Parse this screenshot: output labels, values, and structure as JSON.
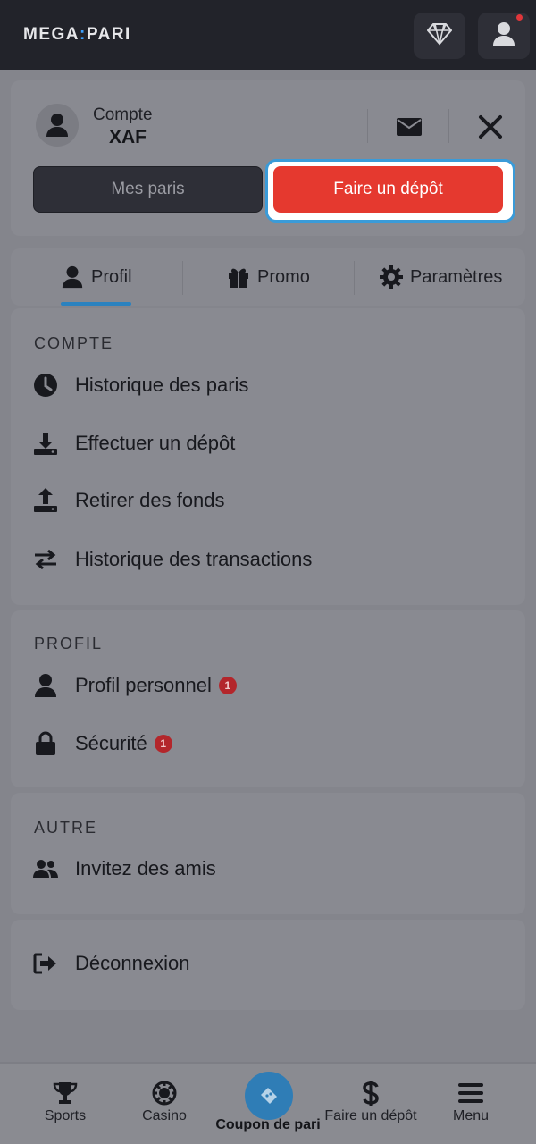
{
  "header": {
    "logo_left": "MEGA",
    "logo_right": "PARI",
    "gem_icon": "diamond-icon",
    "user_icon": "user-icon",
    "accent": "#e0363a"
  },
  "account": {
    "label": "Compte",
    "currency": "XAF",
    "bets_button": "Mes paris",
    "deposit_button": "Faire un dépôt",
    "deposit_color": "#e5392f"
  },
  "tabs": [
    {
      "label": "Profil",
      "icon": "user-icon",
      "active": true
    },
    {
      "label": "Promo",
      "icon": "gift-icon"
    },
    {
      "label": "Paramètres",
      "icon": "gear-icon"
    }
  ],
  "sections": {
    "compte": {
      "title": "COMPTE",
      "items": [
        {
          "label": "Historique des paris",
          "icon": "clock-icon"
        },
        {
          "label": "Effectuer un dépôt",
          "icon": "download-icon"
        },
        {
          "label": "Retirer des fonds",
          "icon": "upload-icon"
        },
        {
          "label": "Historique des transactions",
          "icon": "swap-arrows-icon"
        }
      ]
    },
    "profil": {
      "title": "PROFIL",
      "items": [
        {
          "label": "Profil personnel",
          "icon": "user-icon",
          "badge": "1"
        },
        {
          "label": "Sécurité",
          "icon": "lock-icon",
          "badge": "1"
        }
      ]
    },
    "autre": {
      "title": "AUTRE",
      "items": [
        {
          "label": "Invitez des amis",
          "icon": "users-icon"
        }
      ]
    },
    "logout": {
      "label": "Déconnexion",
      "icon": "logout-icon"
    }
  },
  "bottom_nav": [
    {
      "label": "Sports",
      "icon": "trophy-icon"
    },
    {
      "label": "Casino",
      "icon": "chip-icon"
    },
    {
      "label": "Coupon de pari",
      "icon": "ticket-icon"
    },
    {
      "label": "Faire un dépôt",
      "icon": "dollar-icon"
    },
    {
      "label": "Menu",
      "icon": "hamburger-icon"
    }
  ]
}
